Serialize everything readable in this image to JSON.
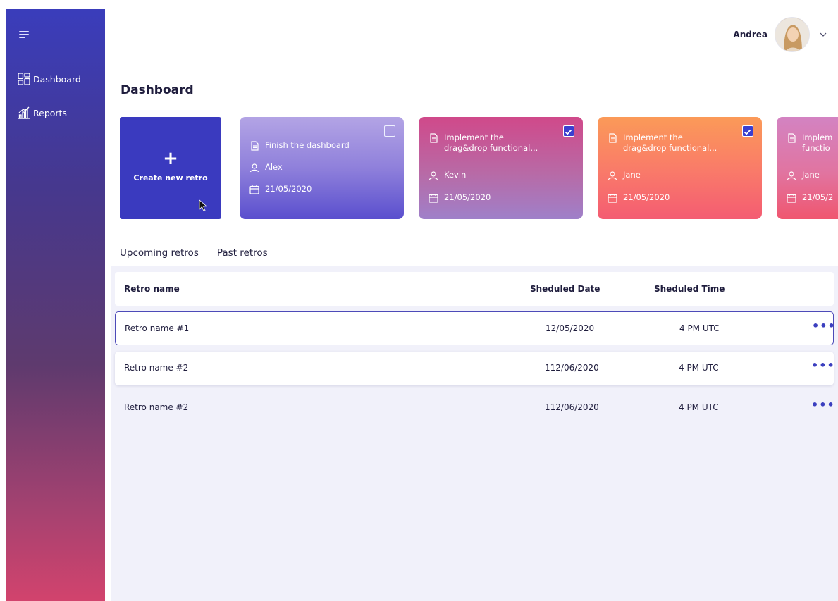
{
  "sidebar": {
    "menu_icon": "hamburger-icon",
    "items": [
      {
        "label": "Dashboard",
        "icon": "dashboard-grid-icon"
      },
      {
        "label": "Reports",
        "icon": "chart-bars-icon"
      }
    ]
  },
  "header": {
    "user_name": "Andrea",
    "avatar_icon": "user-avatar",
    "dropdown_icon": "chevron-down-icon"
  },
  "page": {
    "title": "Dashboard"
  },
  "cards": {
    "create": {
      "plus": "+",
      "label": "Create new retro"
    },
    "items": [
      {
        "title": "Finish the dashboard",
        "title2": "",
        "assignee": "Alex",
        "date": "21/05/2020",
        "checked": false
      },
      {
        "title": "Implement the",
        "title2": "drag&drop functional...",
        "assignee": "Kevin",
        "date": "21/05/2020",
        "checked": true
      },
      {
        "title": "Implement the",
        "title2": "drag&drop functional...",
        "assignee": "Jane",
        "date": "21/05/2020",
        "checked": true
      },
      {
        "title": "Implem",
        "title2": "functio",
        "assignee": "Jane",
        "date": "21/05/2",
        "checked": false
      }
    ]
  },
  "tabs": [
    {
      "label": "Upcoming retros",
      "active": true
    },
    {
      "label": "Past retros",
      "active": false
    }
  ],
  "table": {
    "columns": [
      "Retro name",
      "Sheduled Date",
      "Sheduled Time"
    ],
    "rows": [
      {
        "name": "Retro name #1",
        "date": "12/05/2020",
        "time": "4 PM UTC",
        "more": "•••"
      },
      {
        "name": "Retro name #2",
        "date": "112/06/2020",
        "time": "4 PM UTC",
        "more": "•••"
      },
      {
        "name": "Retro name #2",
        "date": "112/06/2020",
        "time": "4 PM UTC",
        "more": "•••"
      }
    ]
  },
  "colors": {
    "accent": "#3a3abf",
    "tab_underline": "#f2587a",
    "row_selected_border": "#4d4ab8"
  }
}
